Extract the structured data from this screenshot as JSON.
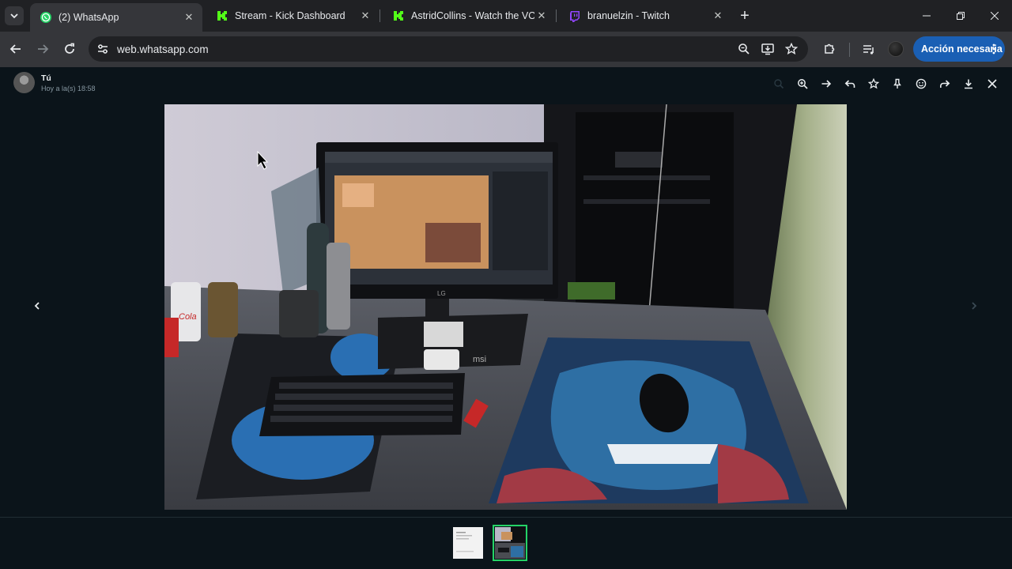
{
  "browser": {
    "tabs": [
      {
        "title": "(2) WhatsApp",
        "icon": "whatsapp-icon",
        "active": true
      },
      {
        "title": "Stream - Kick Dashboard",
        "icon": "kick-icon",
        "active": false
      },
      {
        "title": "AstridCollins - Watch the VOD o",
        "icon": "kick-icon",
        "active": false
      },
      {
        "title": "branuelzin - Twitch",
        "icon": "twitch-icon",
        "active": false
      }
    ],
    "url": "web.whatsapp.com",
    "action_button_label": "Acción necesaria"
  },
  "viewer": {
    "sender_name": "Tú",
    "sender_time": "Hoy a la(s) 18:58",
    "thumbnails": [
      {
        "name": "document-thumbnail",
        "selected": false
      },
      {
        "name": "photo-thumbnail",
        "selected": true
      }
    ],
    "photo": {
      "monitor_brand": "LG",
      "case_brand": "msi",
      "can_label": "Cola"
    }
  },
  "colors": {
    "accent_green": "#25d366",
    "kick_green": "#53fc18",
    "twitch_purple": "#9146ff",
    "action_blue": "#1a5fb4"
  }
}
